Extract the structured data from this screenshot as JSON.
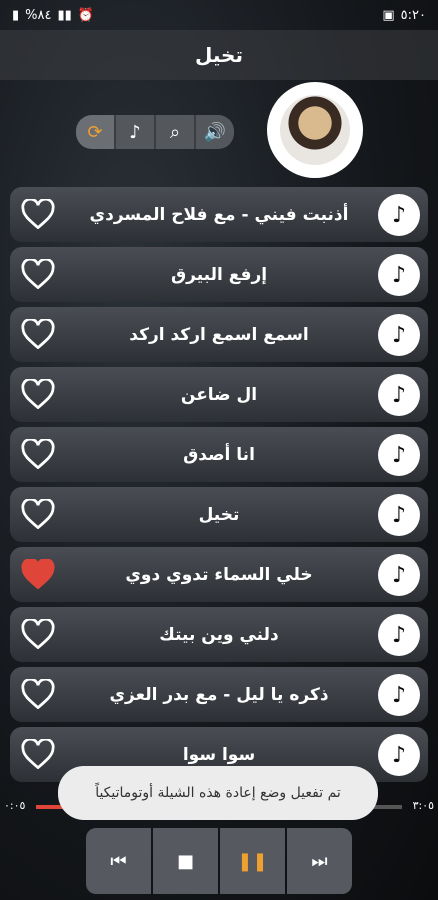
{
  "status_bar": {
    "battery": "%٨٤",
    "time": "٥:٢٠"
  },
  "header": {
    "title": "تخيل"
  },
  "controls": [
    {
      "name": "repeat-icon",
      "glyph": "⟳"
    },
    {
      "name": "music-note-icon",
      "glyph": "♪"
    },
    {
      "name": "search-icon",
      "glyph": "⌕"
    },
    {
      "name": "volume-icon",
      "glyph": "🔊"
    }
  ],
  "songs": [
    {
      "title": "أذنبت فيني - مع فلاح المسردي",
      "favorite": false
    },
    {
      "title": "إرفع البيرق",
      "favorite": false
    },
    {
      "title": "اسمع اسمع اركد اركد",
      "favorite": false
    },
    {
      "title": "ال ضاعن",
      "favorite": false
    },
    {
      "title": "انا أصدق",
      "favorite": false
    },
    {
      "title": "تخيل",
      "favorite": false
    },
    {
      "title": "خلي السماء تدوي دوي",
      "favorite": true
    },
    {
      "title": "دلني وين بيتك",
      "favorite": false
    },
    {
      "title": "ذكره يا ليل - مع بدر العزي",
      "favorite": false
    },
    {
      "title": "سوا سوا",
      "favorite": false
    }
  ],
  "progress": {
    "elapsed": "٠:٠٥",
    "total": "٣:٠٥",
    "fraction": 0.35
  },
  "toast": {
    "message": "تم تفعيل وضع إعادة هذه الشيلة أوتوماتيكياً"
  },
  "player": {
    "prev": "⏮",
    "stop": "■",
    "pause": "❚❚",
    "next": "⏭"
  },
  "colors": {
    "accent": "#f0a030",
    "favorite": "#e0453a"
  }
}
